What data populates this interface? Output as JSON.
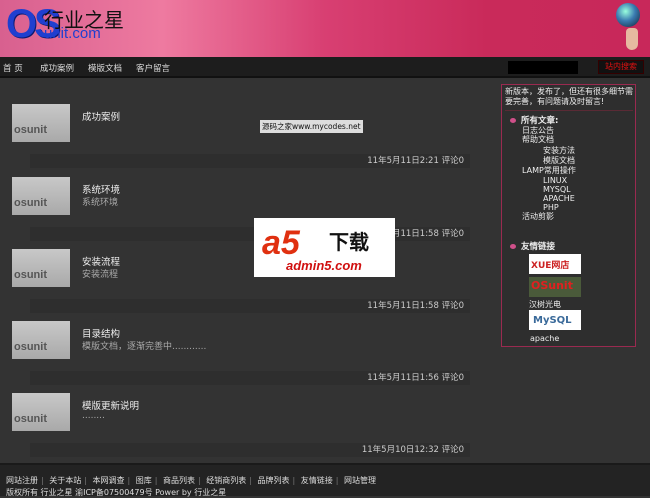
{
  "header": {
    "logo_os": "OS",
    "logo_cn": "行业之星",
    "logo_en": "unit.com"
  },
  "nav": {
    "items": [
      "首 页",
      "成功案例",
      "模版文档",
      "客户留言"
    ],
    "search_placeholder": "",
    "search_button": "站内搜索"
  },
  "posts": [
    {
      "thumb": "osunit",
      "title": "成功案例",
      "desc": "",
      "meta": "11年5月11日2:21 评论0"
    },
    {
      "thumb": "osunit",
      "title": "系统环境",
      "desc": "系统环境",
      "meta": "11年5月11日1:58 评论0"
    },
    {
      "thumb": "osunit",
      "title": "安装流程",
      "desc": "安装流程",
      "meta": "11年5月11日1:58 评论0"
    },
    {
      "thumb": "osunit",
      "title": "目录结构",
      "desc": "模版文档，逐渐完善中............",
      "meta": "11年5月11日1:56 评论0"
    },
    {
      "thumb": "osunit",
      "title": "模版更新说明",
      "desc": "........",
      "meta": "11年5月10日12:32 评论0"
    }
  ],
  "watermarks": {
    "mycodes": "源码之家www.mycodes.net",
    "a5_mark": "a5",
    "a5_xz": "下载",
    "a5_url": "admin5.com"
  },
  "sidebar": {
    "notice": "新版本，发布了，但还有很多细节需要完善，有问题请及时留言!",
    "articles_heading": "所有文章:",
    "articles": [
      "日志公告",
      "帮助文档",
      "安装方法",
      "模版文档",
      "LAMP常用操作",
      "LINUX",
      "MYSQL",
      "APACHE",
      "PHP",
      "活动剪影"
    ],
    "links_heading": "友情链接",
    "links": [
      "汉树光电",
      "apache"
    ],
    "link_logos": [
      "XUE网店",
      "OSunit",
      "MySQL"
    ]
  },
  "footer": {
    "links": [
      "网站注册",
      "关于本站",
      "本网调查",
      "图库",
      "商品列表",
      "经销商列表",
      "品牌列表",
      "友情链接",
      "网站管理"
    ],
    "copyright": "版权所有 行业之星 渝ICP备07500479号 Power by 行业之星"
  }
}
